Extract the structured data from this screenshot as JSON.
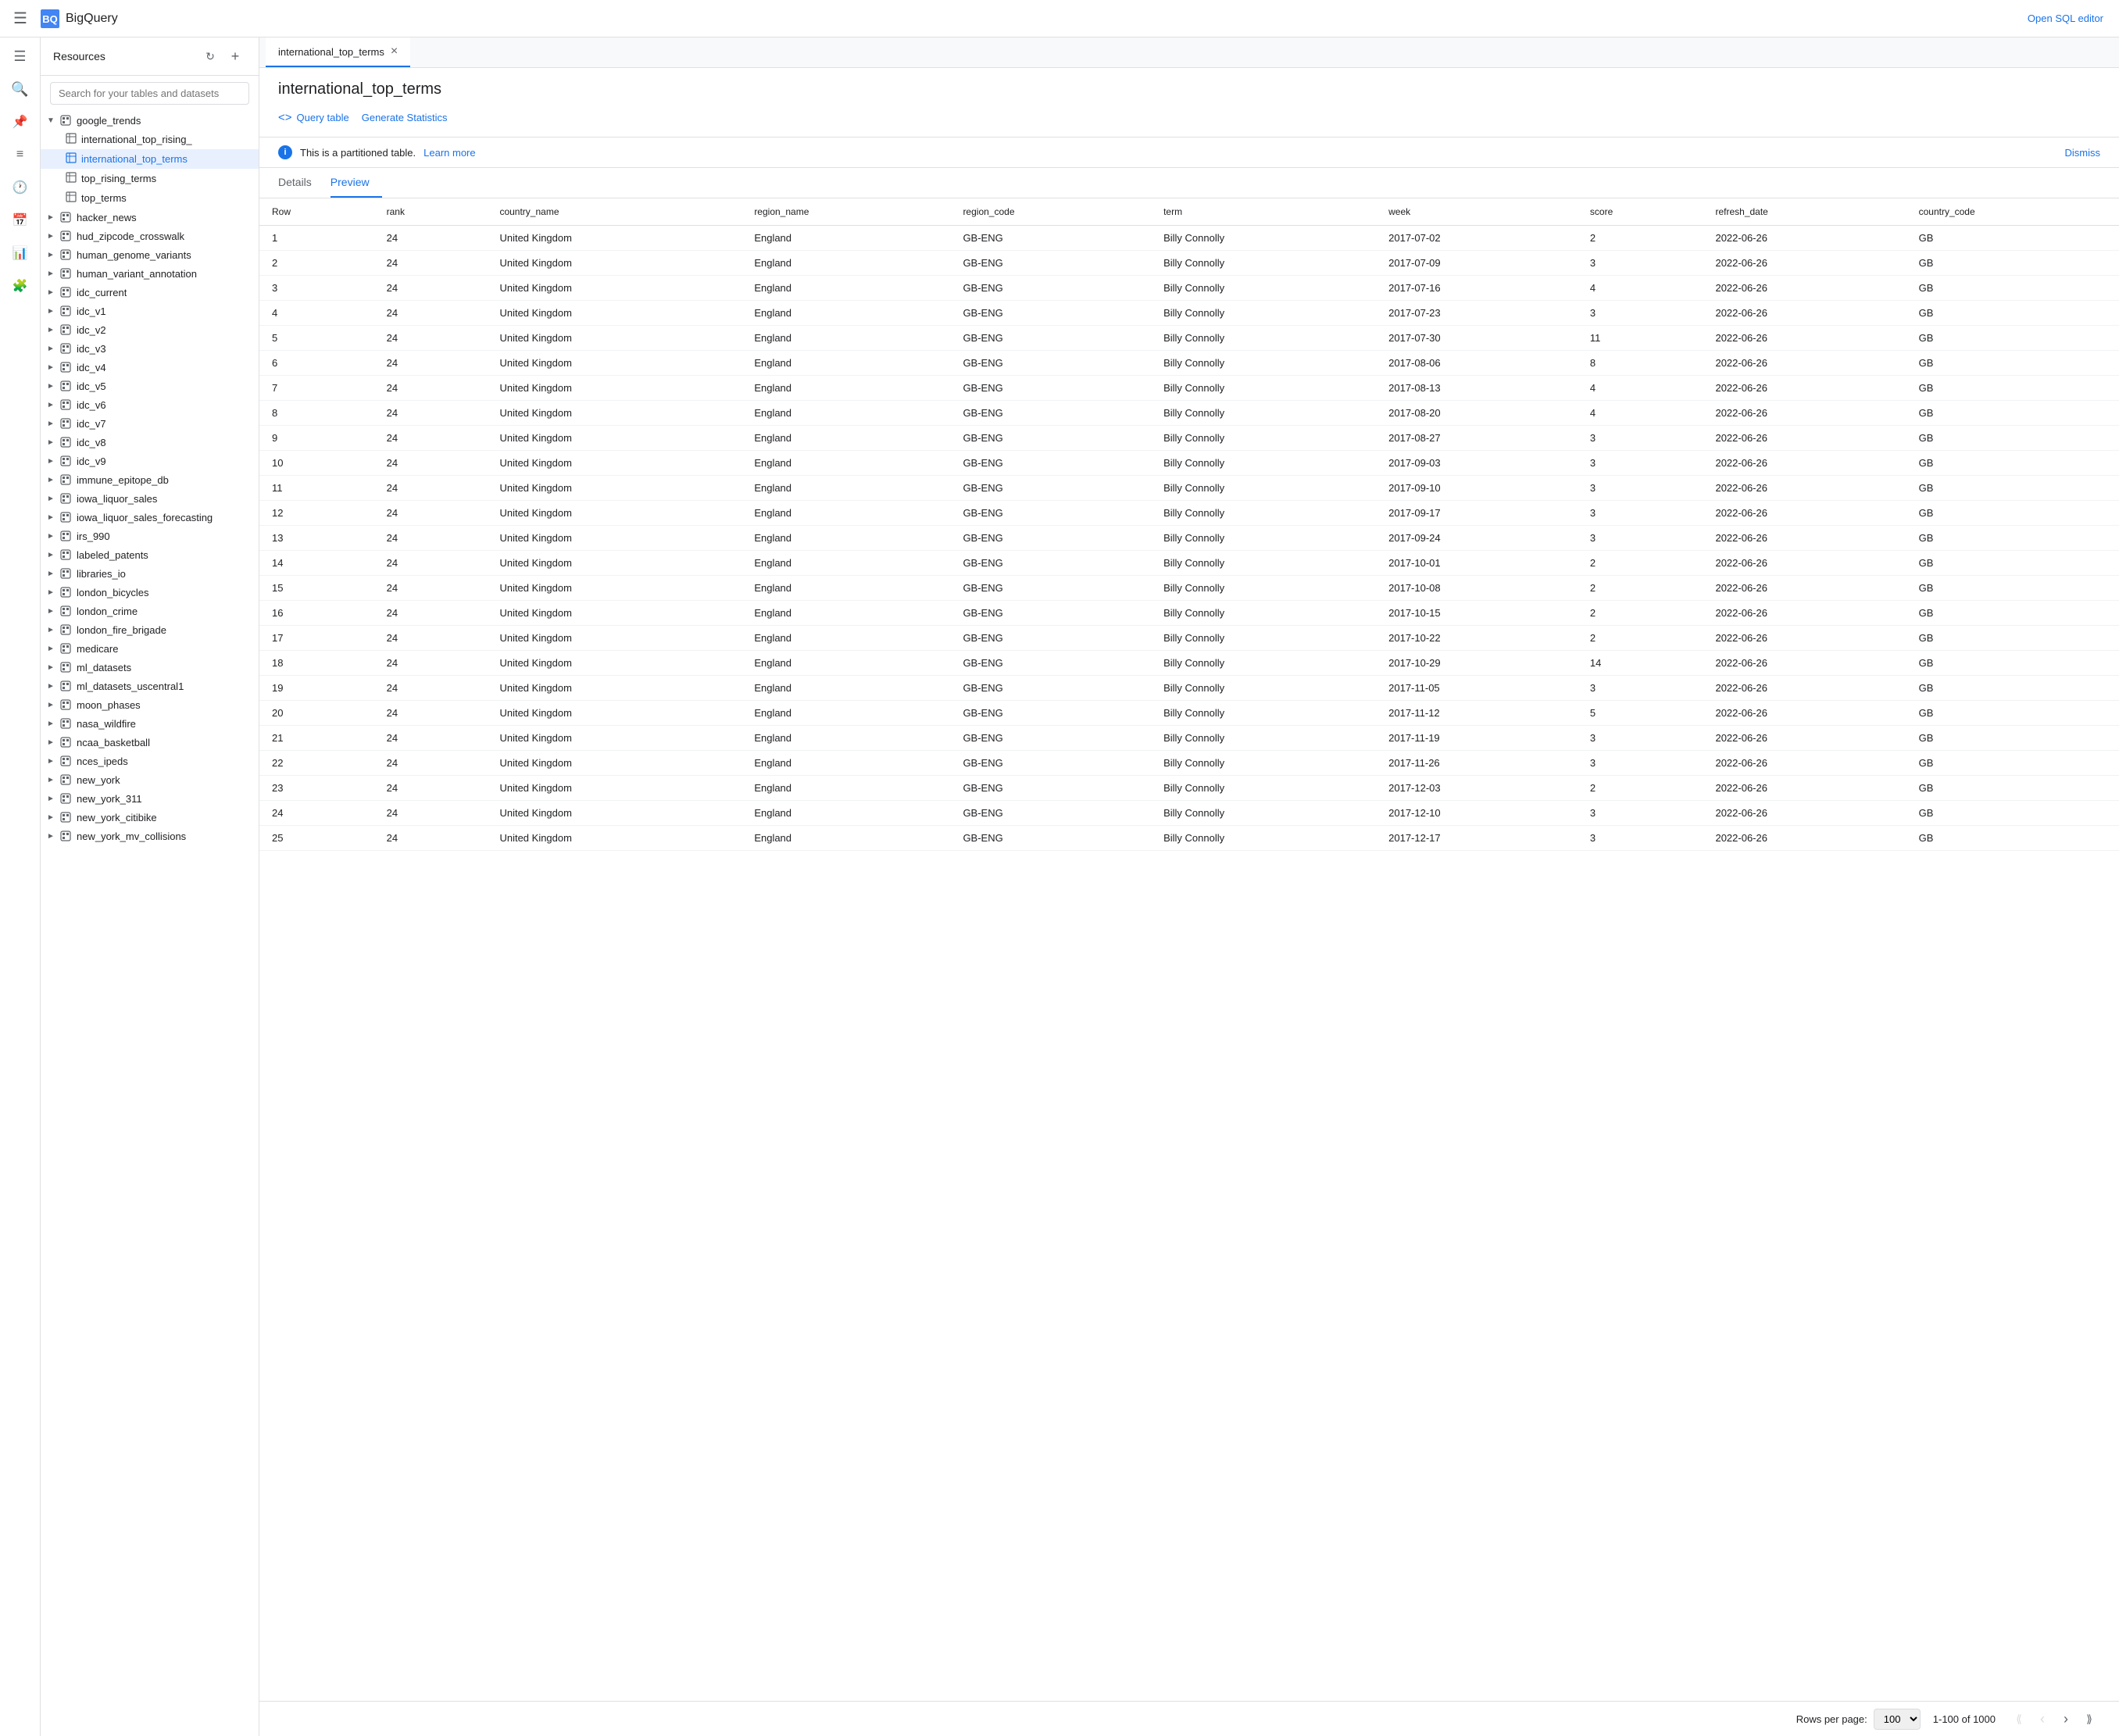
{
  "app": {
    "title": "BigQuery",
    "open_sql_label": "Open SQL editor"
  },
  "sidebar_icons": [
    {
      "name": "menu-icon",
      "symbol": "☰"
    },
    {
      "name": "search-icon",
      "symbol": "🔍"
    },
    {
      "name": "pin-icon",
      "symbol": "📌"
    },
    {
      "name": "history-icon",
      "symbol": "⏱"
    },
    {
      "name": "list-icon",
      "symbol": "≡"
    },
    {
      "name": "schedule-icon",
      "symbol": "📅"
    },
    {
      "name": "monitor-icon",
      "symbol": "📊"
    },
    {
      "name": "puzzle-icon",
      "symbol": "🧩"
    }
  ],
  "resources": {
    "title": "Resources",
    "search_placeholder": "Search for your tables and datasets",
    "tree": [
      {
        "level": 1,
        "label": "google_trends",
        "type": "dataset",
        "expanded": true
      },
      {
        "level": 2,
        "label": "international_top_rising_",
        "type": "table",
        "active": false
      },
      {
        "level": 2,
        "label": "international_top_terms",
        "type": "table",
        "active": true
      },
      {
        "level": 2,
        "label": "top_rising_terms",
        "type": "table",
        "active": false
      },
      {
        "level": 2,
        "label": "top_terms",
        "type": "table",
        "active": false
      },
      {
        "level": 1,
        "label": "hacker_news",
        "type": "dataset",
        "expanded": false
      },
      {
        "level": 1,
        "label": "hud_zipcode_crosswalk",
        "type": "dataset",
        "expanded": false
      },
      {
        "level": 1,
        "label": "human_genome_variants",
        "type": "dataset",
        "expanded": false
      },
      {
        "level": 1,
        "label": "human_variant_annotation",
        "type": "dataset",
        "expanded": false
      },
      {
        "level": 1,
        "label": "idc_current",
        "type": "dataset",
        "expanded": false
      },
      {
        "level": 1,
        "label": "idc_v1",
        "type": "dataset",
        "expanded": false
      },
      {
        "level": 1,
        "label": "idc_v2",
        "type": "dataset",
        "expanded": false
      },
      {
        "level": 1,
        "label": "idc_v3",
        "type": "dataset",
        "expanded": false
      },
      {
        "level": 1,
        "label": "idc_v4",
        "type": "dataset",
        "expanded": false
      },
      {
        "level": 1,
        "label": "idc_v5",
        "type": "dataset",
        "expanded": false
      },
      {
        "level": 1,
        "label": "idc_v6",
        "type": "dataset",
        "expanded": false
      },
      {
        "level": 1,
        "label": "idc_v7",
        "type": "dataset",
        "expanded": false
      },
      {
        "level": 1,
        "label": "idc_v8",
        "type": "dataset",
        "expanded": false
      },
      {
        "level": 1,
        "label": "idc_v9",
        "type": "dataset",
        "expanded": false
      },
      {
        "level": 1,
        "label": "immune_epitope_db",
        "type": "dataset",
        "expanded": false
      },
      {
        "level": 1,
        "label": "iowa_liquor_sales",
        "type": "dataset",
        "expanded": false
      },
      {
        "level": 1,
        "label": "iowa_liquor_sales_forecasting",
        "type": "dataset",
        "expanded": false
      },
      {
        "level": 1,
        "label": "irs_990",
        "type": "dataset",
        "expanded": false
      },
      {
        "level": 1,
        "label": "labeled_patents",
        "type": "dataset",
        "expanded": false
      },
      {
        "level": 1,
        "label": "libraries_io",
        "type": "dataset",
        "expanded": false
      },
      {
        "level": 1,
        "label": "london_bicycles",
        "type": "dataset",
        "expanded": false
      },
      {
        "level": 1,
        "label": "london_crime",
        "type": "dataset",
        "expanded": false
      },
      {
        "level": 1,
        "label": "london_fire_brigade",
        "type": "dataset",
        "expanded": false
      },
      {
        "level": 1,
        "label": "medicare",
        "type": "dataset",
        "expanded": false
      },
      {
        "level": 1,
        "label": "ml_datasets",
        "type": "dataset",
        "expanded": false
      },
      {
        "level": 1,
        "label": "ml_datasets_uscentral1",
        "type": "dataset",
        "expanded": false
      },
      {
        "level": 1,
        "label": "moon_phases",
        "type": "dataset",
        "expanded": false
      },
      {
        "level": 1,
        "label": "nasa_wildfire",
        "type": "dataset",
        "expanded": false
      },
      {
        "level": 1,
        "label": "ncaa_basketball",
        "type": "dataset",
        "expanded": false
      },
      {
        "level": 1,
        "label": "nces_ipeds",
        "type": "dataset",
        "expanded": false
      },
      {
        "level": 1,
        "label": "new_york",
        "type": "dataset",
        "expanded": false
      },
      {
        "level": 1,
        "label": "new_york_311",
        "type": "dataset",
        "expanded": false
      },
      {
        "level": 1,
        "label": "new_york_citibike",
        "type": "dataset",
        "expanded": false
      },
      {
        "level": 1,
        "label": "new_york_mv_collisions",
        "type": "dataset",
        "expanded": false
      }
    ]
  },
  "tab": {
    "label": "international_top_terms",
    "close_label": "×"
  },
  "page": {
    "title": "international_top_terms",
    "query_table_label": "Query table",
    "generate_statistics_label": "Generate Statistics",
    "info_message": "This is a partitioned table.",
    "learn_more_label": "Learn more",
    "dismiss_label": "Dismiss"
  },
  "sub_tabs": [
    {
      "label": "Details",
      "active": false
    },
    {
      "label": "Preview",
      "active": true
    }
  ],
  "table": {
    "columns": [
      "Row",
      "rank",
      "country_name",
      "region_name",
      "region_code",
      "term",
      "week",
      "score",
      "refresh_date",
      "country_code"
    ],
    "rows": [
      [
        1,
        24,
        "United Kingdom",
        "England",
        "GB-ENG",
        "Billy Connolly",
        "2017-07-02",
        2,
        "2022-06-26",
        "GB"
      ],
      [
        2,
        24,
        "United Kingdom",
        "England",
        "GB-ENG",
        "Billy Connolly",
        "2017-07-09",
        3,
        "2022-06-26",
        "GB"
      ],
      [
        3,
        24,
        "United Kingdom",
        "England",
        "GB-ENG",
        "Billy Connolly",
        "2017-07-16",
        4,
        "2022-06-26",
        "GB"
      ],
      [
        4,
        24,
        "United Kingdom",
        "England",
        "GB-ENG",
        "Billy Connolly",
        "2017-07-23",
        3,
        "2022-06-26",
        "GB"
      ],
      [
        5,
        24,
        "United Kingdom",
        "England",
        "GB-ENG",
        "Billy Connolly",
        "2017-07-30",
        11,
        "2022-06-26",
        "GB"
      ],
      [
        6,
        24,
        "United Kingdom",
        "England",
        "GB-ENG",
        "Billy Connolly",
        "2017-08-06",
        8,
        "2022-06-26",
        "GB"
      ],
      [
        7,
        24,
        "United Kingdom",
        "England",
        "GB-ENG",
        "Billy Connolly",
        "2017-08-13",
        4,
        "2022-06-26",
        "GB"
      ],
      [
        8,
        24,
        "United Kingdom",
        "England",
        "GB-ENG",
        "Billy Connolly",
        "2017-08-20",
        4,
        "2022-06-26",
        "GB"
      ],
      [
        9,
        24,
        "United Kingdom",
        "England",
        "GB-ENG",
        "Billy Connolly",
        "2017-08-27",
        3,
        "2022-06-26",
        "GB"
      ],
      [
        10,
        24,
        "United Kingdom",
        "England",
        "GB-ENG",
        "Billy Connolly",
        "2017-09-03",
        3,
        "2022-06-26",
        "GB"
      ],
      [
        11,
        24,
        "United Kingdom",
        "England",
        "GB-ENG",
        "Billy Connolly",
        "2017-09-10",
        3,
        "2022-06-26",
        "GB"
      ],
      [
        12,
        24,
        "United Kingdom",
        "England",
        "GB-ENG",
        "Billy Connolly",
        "2017-09-17",
        3,
        "2022-06-26",
        "GB"
      ],
      [
        13,
        24,
        "United Kingdom",
        "England",
        "GB-ENG",
        "Billy Connolly",
        "2017-09-24",
        3,
        "2022-06-26",
        "GB"
      ],
      [
        14,
        24,
        "United Kingdom",
        "England",
        "GB-ENG",
        "Billy Connolly",
        "2017-10-01",
        2,
        "2022-06-26",
        "GB"
      ],
      [
        15,
        24,
        "United Kingdom",
        "England",
        "GB-ENG",
        "Billy Connolly",
        "2017-10-08",
        2,
        "2022-06-26",
        "GB"
      ],
      [
        16,
        24,
        "United Kingdom",
        "England",
        "GB-ENG",
        "Billy Connolly",
        "2017-10-15",
        2,
        "2022-06-26",
        "GB"
      ],
      [
        17,
        24,
        "United Kingdom",
        "England",
        "GB-ENG",
        "Billy Connolly",
        "2017-10-22",
        2,
        "2022-06-26",
        "GB"
      ],
      [
        18,
        24,
        "United Kingdom",
        "England",
        "GB-ENG",
        "Billy Connolly",
        "2017-10-29",
        14,
        "2022-06-26",
        "GB"
      ],
      [
        19,
        24,
        "United Kingdom",
        "England",
        "GB-ENG",
        "Billy Connolly",
        "2017-11-05",
        3,
        "2022-06-26",
        "GB"
      ],
      [
        20,
        24,
        "United Kingdom",
        "England",
        "GB-ENG",
        "Billy Connolly",
        "2017-11-12",
        5,
        "2022-06-26",
        "GB"
      ],
      [
        21,
        24,
        "United Kingdom",
        "England",
        "GB-ENG",
        "Billy Connolly",
        "2017-11-19",
        3,
        "2022-06-26",
        "GB"
      ],
      [
        22,
        24,
        "United Kingdom",
        "England",
        "GB-ENG",
        "Billy Connolly",
        "2017-11-26",
        3,
        "2022-06-26",
        "GB"
      ],
      [
        23,
        24,
        "United Kingdom",
        "England",
        "GB-ENG",
        "Billy Connolly",
        "2017-12-03",
        2,
        "2022-06-26",
        "GB"
      ],
      [
        24,
        24,
        "United Kingdom",
        "England",
        "GB-ENG",
        "Billy Connolly",
        "2017-12-10",
        3,
        "2022-06-26",
        "GB"
      ],
      [
        25,
        24,
        "United Kingdom",
        "England",
        "GB-ENG",
        "Billy Connolly",
        "2017-12-17",
        3,
        "2022-06-26",
        "GB"
      ]
    ]
  },
  "footer": {
    "rows_per_page_label": "Rows per page:",
    "rows_per_page_value": "100",
    "pagination_info": "1-100 of 1000",
    "first_page_label": "«",
    "prev_page_label": "‹",
    "next_page_label": "›",
    "last_page_label": "»"
  }
}
